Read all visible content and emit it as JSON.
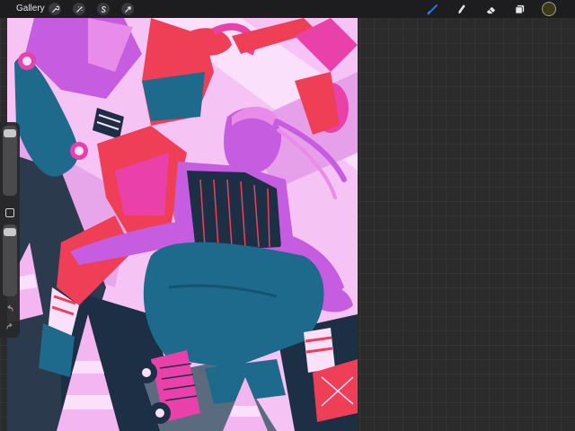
{
  "toolbar": {
    "gallery_label": "Gallery",
    "left_tools": [
      {
        "name": "actions-wrench-icon"
      },
      {
        "name": "adjustments-wand-icon"
      },
      {
        "name": "selection-s-icon"
      },
      {
        "name": "transform-arrow-icon"
      }
    ],
    "right_tools": [
      {
        "name": "brush-icon",
        "active": true
      },
      {
        "name": "smudge-icon",
        "active": false
      },
      {
        "name": "eraser-icon",
        "active": false
      },
      {
        "name": "layers-icon",
        "active": false
      }
    ],
    "current_color": "#3b3a12"
  },
  "sidebar": {
    "brush_size_level": 0.95,
    "opacity_level": 0.95,
    "icons": [
      "modify-square-icon",
      "undo-arrow-icon",
      "redo-arrow-icon"
    ]
  },
  "colors": {
    "active_tool": "#2f7bf6",
    "tool_icon": "#e6e6e6",
    "canvas_pink": "#f6c3f5",
    "magenta": "#e940a9",
    "purple": "#c65de0",
    "teal": "#1e6a8c",
    "red": "#ef3f57",
    "navy": "#1d2f45",
    "slate": "#5b6b7e"
  }
}
